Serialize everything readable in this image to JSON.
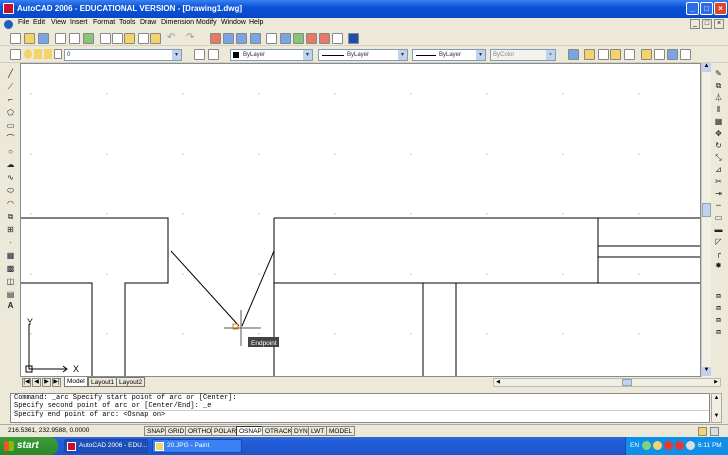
{
  "window": {
    "title": "AutoCAD 2006 - EDUCATIONAL VERSION - [Drawing1.dwg]",
    "controls": [
      "_",
      "□",
      "×"
    ]
  },
  "doc_controls": [
    "_",
    "□",
    "×"
  ],
  "menu": [
    "File",
    "Edit",
    "View",
    "Insert",
    "Format",
    "Tools",
    "Draw",
    "Dimension",
    "Modify",
    "Window",
    "Help"
  ],
  "properties": {
    "layer": "0",
    "color": "ByLayer",
    "linetype": "ByLayer",
    "lineweight": "ByLayer",
    "plotstyle": "ByColor"
  },
  "drawing": {
    "snap_tooltip": "Endpoint",
    "ucs_x": "X",
    "ucs_y": "Y"
  },
  "layout_tabs": [
    {
      "label": "Model",
      "active": true
    },
    {
      "label": "Layout1",
      "active": false
    },
    {
      "label": "Layout2",
      "active": false
    }
  ],
  "command_lines": [
    "Command: _arc Specify start point of arc or [Center]:",
    "Specify second point of arc or [Center/End]: _e",
    "Specify end point of arc: <Osnap on>"
  ],
  "status": {
    "coords": "216.5361, 232.9588, 0.0000",
    "toggles": [
      {
        "label": "SNAP",
        "on": false
      },
      {
        "label": "GRID",
        "on": false
      },
      {
        "label": "ORTHO",
        "on": false
      },
      {
        "label": "POLAR",
        "on": false
      },
      {
        "label": "OSNAP",
        "on": true
      },
      {
        "label": "OTRACK",
        "on": false
      },
      {
        "label": "DYN",
        "on": false
      },
      {
        "label": "LWT",
        "on": false
      },
      {
        "label": "MODEL",
        "on": false
      }
    ]
  },
  "taskbar": {
    "start": "start",
    "tasks": [
      {
        "label": "AutoCAD 2006 - EDU...",
        "active": true
      },
      {
        "label": "20.JPG - Paint",
        "active": false
      }
    ],
    "language": "EN",
    "clock": "6:11 PM"
  },
  "colors": {
    "titlebar": "#0A52D6",
    "taskbar": "#245EDC",
    "start_button": "#3C9C3C",
    "tray": "#0F8FE8",
    "chrome": "#ECE9D8",
    "canvas": "#FFFFFF"
  }
}
